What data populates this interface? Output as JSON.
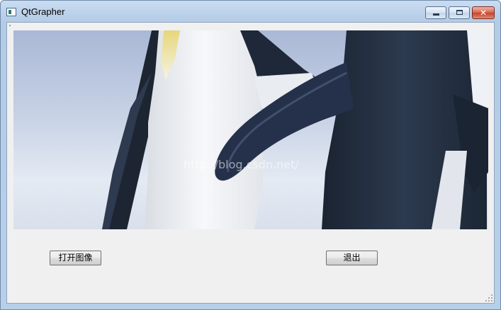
{
  "window": {
    "title": "QtGrapher",
    "controls": {
      "minimize": "minimize",
      "maximize": "maximize",
      "close": "close"
    }
  },
  "image": {
    "subject": "penguins",
    "watermark": "http://blog.csdn.net/"
  },
  "buttons": {
    "open_image": "打开图像",
    "exit": "退出"
  },
  "icons": [
    "app-icon",
    "minimize-icon",
    "maximize-icon",
    "close-icon",
    "size-grip-icon"
  ],
  "colors": {
    "titlebar": "#c9dcf1",
    "client": "#f0f0f0",
    "close_button": "#c8402a"
  }
}
